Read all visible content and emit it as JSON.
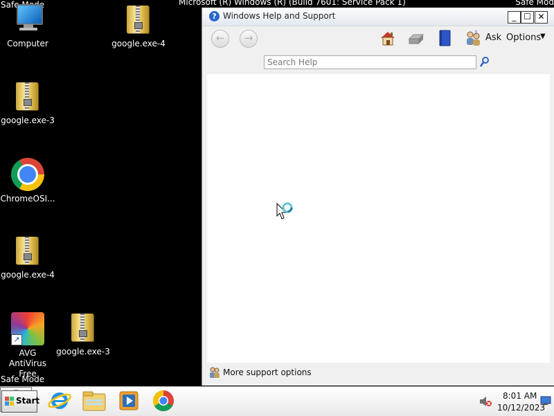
{
  "desktop": {
    "safe_mode_top_left": "Safe Mode",
    "safe_mode_bottom_left": "Safe Mode",
    "safe_mode_top_right": "Safe Mod",
    "banner": "Microsoft (R) Windows (R) (Build 7601: Service Pack 1)",
    "icons": [
      {
        "label": "Computer",
        "icon": "computer-icon"
      },
      {
        "label": "google.exe-4",
        "icon": "zip-folder-icon"
      },
      {
        "label": "google.exe-3",
        "icon": "zip-folder-icon"
      },
      {
        "label": "ChromeOSI...",
        "icon": "chrome-icon"
      },
      {
        "label": "google.exe-4",
        "icon": "zip-folder-icon"
      },
      {
        "label": "AVG AntiVirus Free",
        "icon": "avg-icon"
      },
      {
        "label": "google.exe-3",
        "icon": "zip-folder-icon"
      }
    ]
  },
  "help_window": {
    "title": "Windows Help and Support",
    "toolbar": {
      "ask_label": "Ask",
      "options_label": "Options"
    },
    "search": {
      "placeholder": "Search Help",
      "value": ""
    },
    "footer_label": "More support options"
  },
  "taskbar": {
    "start_label": "Start",
    "items": [
      "internet-explorer-icon",
      "windows-explorer-icon",
      "media-player-icon",
      "chrome-icon",
      "help-icon"
    ],
    "clock_time": "8:01 AM",
    "clock_date": "10/12/2023"
  },
  "colors": {
    "desktop_background": "#000000",
    "window_chrome": "#f0f0f0",
    "help_blue": "#2a66c8"
  }
}
